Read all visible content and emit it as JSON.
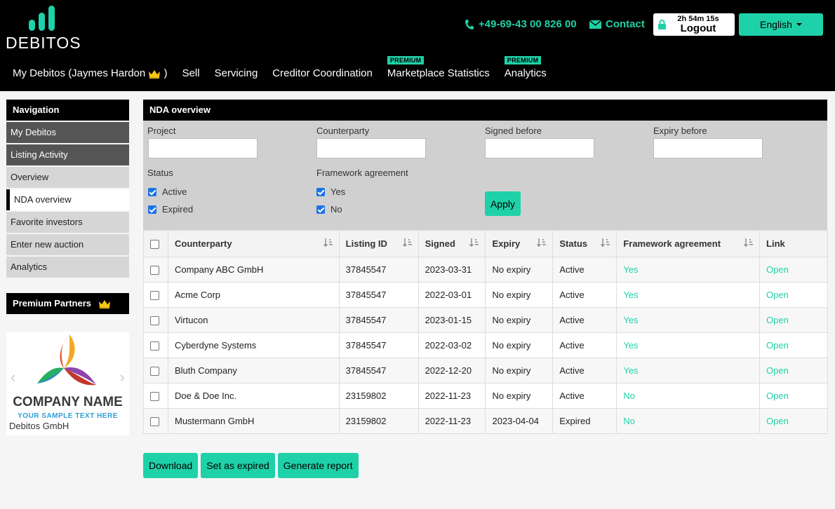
{
  "brand": {
    "name": "DEBITOS"
  },
  "header": {
    "phone": "+49-69-43 00 826 00",
    "contact": "Contact",
    "session_timer": "2h 54m 15s",
    "logout": "Logout",
    "language": "English",
    "accent_color": "#1fd1a8"
  },
  "topnav": {
    "items": [
      {
        "label": "My Debitos (Jaymes Hardon",
        "suffix": ")",
        "badge": ""
      },
      {
        "label": "Sell",
        "badge": ""
      },
      {
        "label": "Servicing",
        "badge": ""
      },
      {
        "label": "Creditor Coordination",
        "badge": ""
      },
      {
        "label": "Marketplace Statistics",
        "badge": "PREMIUM"
      },
      {
        "label": "Analytics",
        "badge": "PREMIUM"
      }
    ]
  },
  "sidebar": {
    "heading": "Navigation",
    "items": [
      {
        "label": "My Debitos"
      },
      {
        "label": "Listing Activity"
      },
      {
        "label": "Overview"
      },
      {
        "label": "NDA overview"
      },
      {
        "label": "Favorite investors"
      },
      {
        "label": "Enter new auction"
      },
      {
        "label": "Analytics"
      }
    ],
    "partners_heading": "Premium Partners",
    "partner_logo_name": "COMPANY NAME",
    "partner_logo_tagline": "YOUR SAMPLE TEXT HERE",
    "partner_caption": "Debitos GmbH"
  },
  "main": {
    "title": "NDA overview",
    "filters": {
      "project_label": "Project",
      "counterparty_label": "Counterparty",
      "signed_before_label": "Signed before",
      "expiry_before_label": "Expiry before",
      "status_label": "Status",
      "status_options": [
        "Active",
        "Expired"
      ],
      "framework_label": "Framework agreement",
      "framework_options": [
        "Yes",
        "No"
      ],
      "apply": "Apply"
    },
    "table": {
      "columns": [
        "Counterparty",
        "Listing ID",
        "Signed",
        "Expiry",
        "Status",
        "Framework agreement",
        "Link"
      ],
      "rows": [
        [
          "Company ABC GmbH",
          "37845547",
          "2023-03-31",
          "No expiry",
          "Active",
          "Yes",
          "Open"
        ],
        [
          "Acme Corp",
          "37845547",
          "2022-03-01",
          "No expiry",
          "Active",
          "Yes",
          "Open"
        ],
        [
          "Virtucon",
          "37845547",
          "2023-01-15",
          "No expiry",
          "Active",
          "Yes",
          "Open"
        ],
        [
          "Cyberdyne Systems",
          "37845547",
          "2022-03-02",
          "No expiry",
          "Active",
          "Yes",
          "Open"
        ],
        [
          "Bluth Company",
          "37845547",
          "2022-12-20",
          "No expiry",
          "Active",
          "Yes",
          "Open"
        ],
        [
          "Doe & Doe Inc.",
          "23159802",
          "2022-11-23",
          "No expiry",
          "Active",
          "No",
          "Open"
        ],
        [
          "Mustermann GmbH",
          "23159802",
          "2022-11-23",
          "2023-04-04",
          "Expired",
          "No",
          "Open"
        ]
      ]
    },
    "actions": [
      "Download",
      "Set as expired",
      "Generate report"
    ]
  }
}
